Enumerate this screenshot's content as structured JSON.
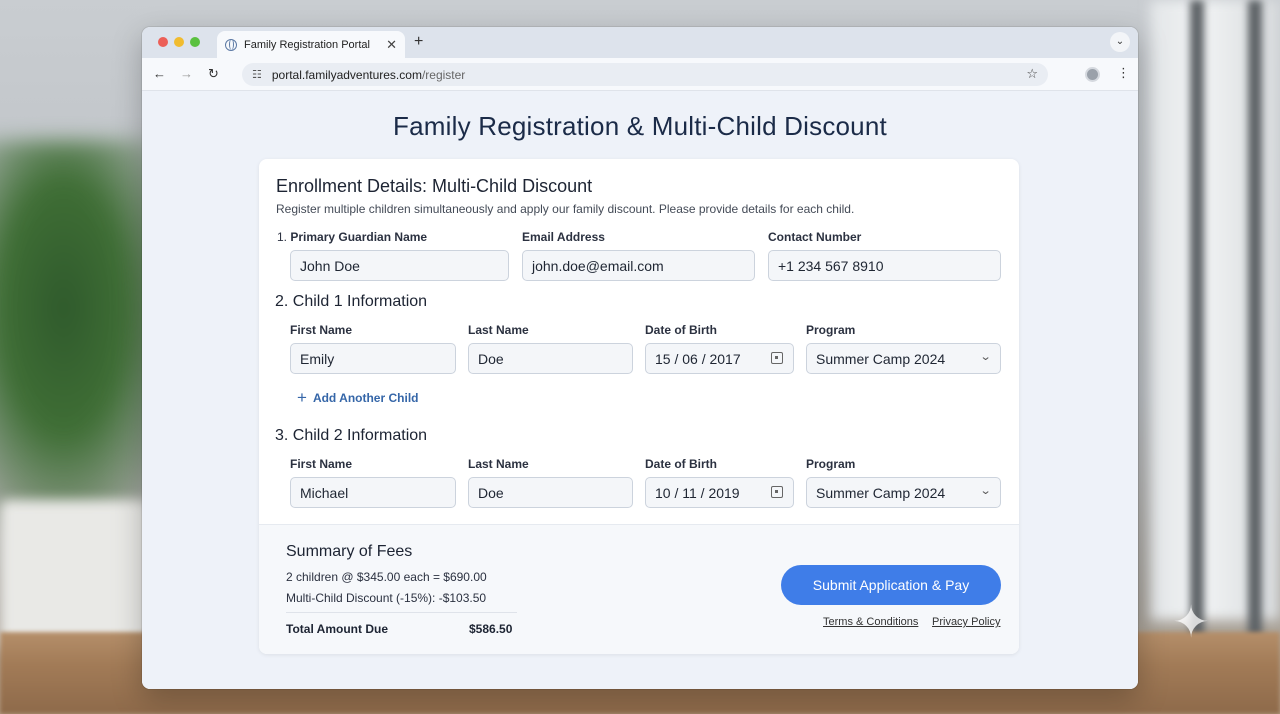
{
  "browser": {
    "tab_title": "Family Registration Portal",
    "url_host": "portal.familyadventures.com",
    "url_path": "/register"
  },
  "page": {
    "title": "Family Registration & Multi-Child Discount"
  },
  "card": {
    "title": "Enrollment Details: Multi-Child Discount",
    "subtitle": "Register multiple children simultaneously and apply our family discount. Please provide details for each child."
  },
  "guardian": {
    "number": "1.",
    "name_label": "Primary Guardian Name",
    "name_value": "John Doe",
    "email_label": "Email Address",
    "email_value": "john.doe@email.com",
    "contact_label": "Contact Number",
    "contact_value": "+1 234 567 8910"
  },
  "child1": {
    "heading": "2. Child 1 Information",
    "first_label": "First Name",
    "first_value": "Emily",
    "last_label": "Last Name",
    "last_value": "Doe",
    "dob_label": "Date of Birth",
    "dob_value": "15 / 06 / 2017",
    "program_label": "Program",
    "program_value": "Summer Camp 2024"
  },
  "add_child_label": "Add Another Child",
  "child2": {
    "heading": "3. Child 2 Information",
    "first_label": "First Name",
    "first_value": "Michael",
    "last_label": "Last Name",
    "last_value": "Doe",
    "dob_label": "Date of Birth",
    "dob_value": "10 / 11 / 2019",
    "program_label": "Program",
    "program_value": "Summer Camp 2024"
  },
  "summary": {
    "title": "Summary of Fees",
    "line1": "2 children @ $345.00 each = $690.00",
    "line2": "Multi-Child Discount (-15%): -$103.50",
    "total_label": "Total Amount Due",
    "total_value": "$586.50",
    "submit_label": "Submit Application & Pay",
    "terms_label": "Terms & Conditions",
    "privacy_label": "Privacy Policy"
  },
  "colors": {
    "accent": "#3f7de8",
    "link": "#3566a8",
    "title": "#1b2b48"
  }
}
